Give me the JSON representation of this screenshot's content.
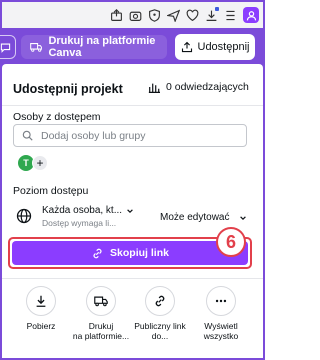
{
  "toolbar": {
    "canva_print_label": "Drukuj na platformie Canva",
    "share_label": "Udostępnij"
  },
  "panel": {
    "title": "Udostępnij projekt",
    "visitors": "0 odwiedzających",
    "people_label": "Osoby z dostępem",
    "search_placeholder": "Dodaj osoby lub grupy",
    "avatar_initial": "T",
    "access_level_label": "Poziom dostępu",
    "access_main": "Każda osoba, kt...",
    "access_sub": "Dostęp wymaga li...",
    "permission": "Może edytować",
    "copy_link": "Skopiuj link",
    "step_number": "6"
  },
  "actions": [
    {
      "label": "Pobierz",
      "icon": "download-icon"
    },
    {
      "label": "Drukuj\nna platformie...",
      "icon": "truck-icon"
    },
    {
      "label": "Publiczny link\ndo...",
      "icon": "link-icon"
    },
    {
      "label": "Wyświetl\nwszystko",
      "icon": "more-icon"
    }
  ],
  "colors": {
    "brand": "#8b3dff",
    "toolbar": "#7b4bd9",
    "highlight": "#e2404b",
    "avatar": "#2fa84f"
  }
}
